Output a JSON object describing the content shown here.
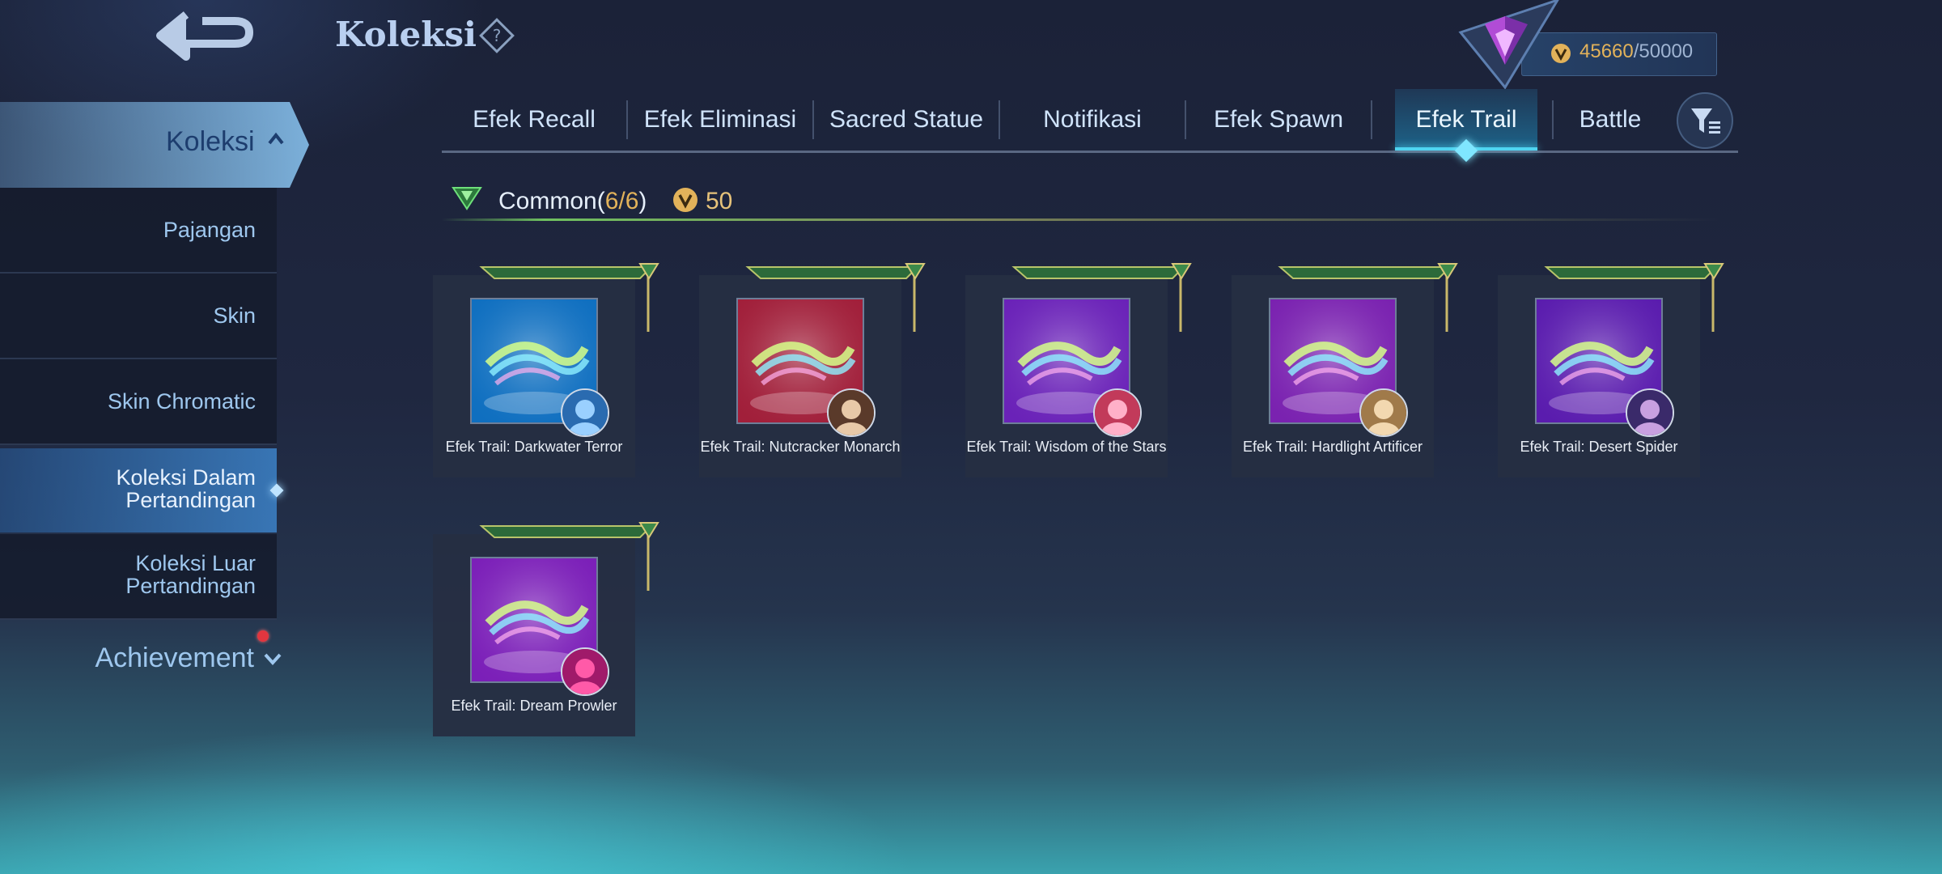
{
  "header": {
    "title": "Koleksi",
    "points": "45660",
    "points_max": "/50000"
  },
  "sidebar": {
    "active_section": "Koleksi",
    "items": [
      {
        "label": "Pajangan"
      },
      {
        "label": "Skin"
      },
      {
        "label": "Skin Chromatic"
      },
      {
        "label": "Koleksi Dalam Pertandingan",
        "line1": "Koleksi Dalam",
        "line2": "Pertandingan",
        "selected": true
      },
      {
        "label": "Koleksi Luar Pertandingan",
        "line1": "Koleksi Luar",
        "line2": "Pertandingan"
      }
    ],
    "achievement": "Achievement"
  },
  "tabs": [
    {
      "label": "Efek Recall"
    },
    {
      "label": "Efek Eliminasi"
    },
    {
      "label": "Sacred Statue"
    },
    {
      "label": "Notifikasi"
    },
    {
      "label": "Efek Spawn"
    },
    {
      "label": "Efek Trail",
      "active": true
    },
    {
      "label": "Battle"
    }
  ],
  "section": {
    "name": "Common(",
    "count": "6/6",
    "close": ")",
    "reward": "50"
  },
  "items": [
    {
      "name": "Efek Trail: Darkwater Terror",
      "theme": "#0f6fc0"
    },
    {
      "name": "Efek Trail: Nutcracker Monarch",
      "theme": "#a11f3a"
    },
    {
      "name": "Efek Trail: Wisdom of the Stars",
      "theme": "#6a22b8"
    },
    {
      "name": "Efek Trail: Hardlight Artificer",
      "theme": "#7a22b0"
    },
    {
      "name": "Efek Trail: Desert Spider",
      "theme": "#5a1cae"
    },
    {
      "name": "Efek Trail: Dream Prowler",
      "theme": "#7b1fb8"
    }
  ],
  "icons": {
    "back": "back-arrow-icon",
    "help": "question-diamond-icon",
    "filter": "filter-list-icon",
    "coin": "coin-icon",
    "rank": "rank-emblem-icon"
  },
  "colors": {
    "accent_cyan": "#4fd4f0",
    "gold": "#e2b25a",
    "badge_red": "#e2363f"
  }
}
